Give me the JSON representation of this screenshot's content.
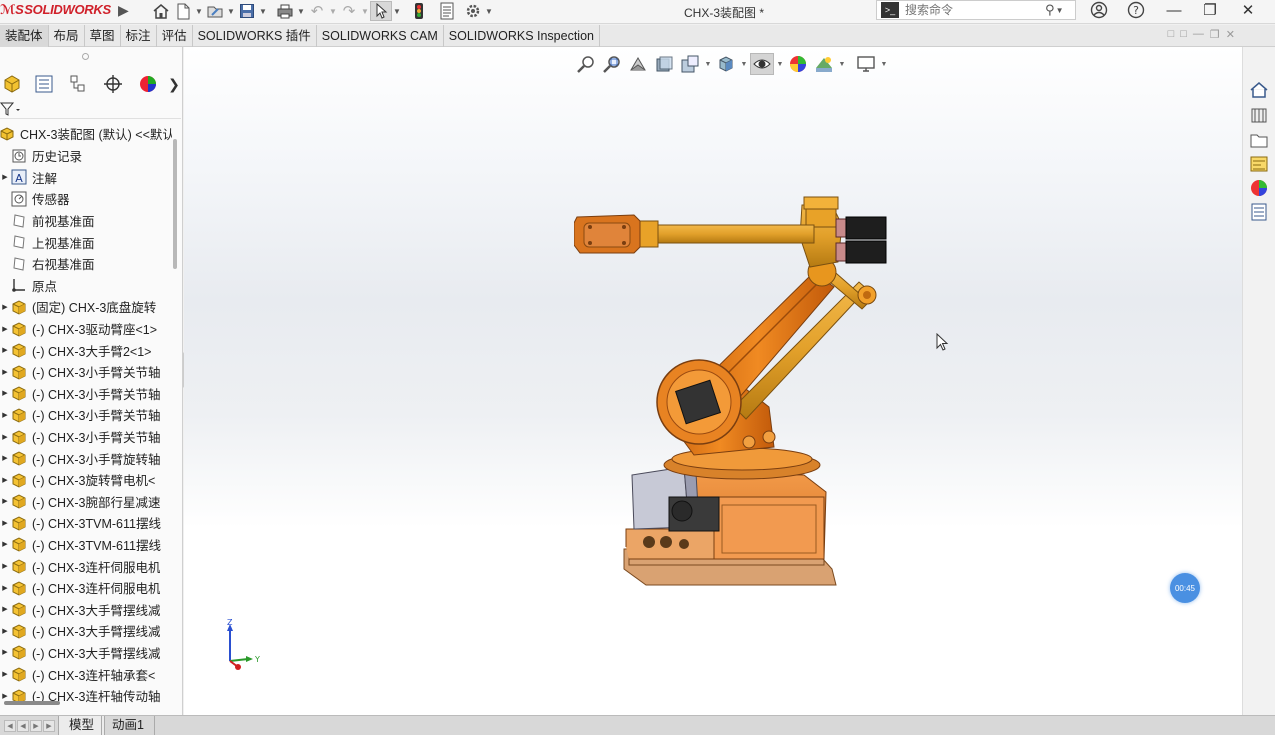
{
  "app": {
    "logo_prefix": "ℳS",
    "logo_text": "SOLIDWORKS",
    "document_title": "CHX-3装配图 *"
  },
  "search": {
    "placeholder": "搜索命令"
  },
  "command_tabs": [
    {
      "label": "装配体",
      "active": true
    },
    {
      "label": "布局"
    },
    {
      "label": "草图"
    },
    {
      "label": "标注"
    },
    {
      "label": "评估"
    },
    {
      "label": "SOLIDWORKS 插件"
    },
    {
      "label": "SOLIDWORKS CAM"
    },
    {
      "label": "SOLIDWORKS Inspection"
    }
  ],
  "tree": {
    "root": "CHX-3装配图 (默认) <<默认",
    "items": [
      {
        "label": "历史记录",
        "icon": "history-icon",
        "expand": false
      },
      {
        "label": "注解",
        "icon": "annotation-icon",
        "expand": true
      },
      {
        "label": "传感器",
        "icon": "sensor-icon",
        "expand": false
      },
      {
        "label": "前视基准面",
        "icon": "plane-icon",
        "expand": false
      },
      {
        "label": "上视基准面",
        "icon": "plane-icon",
        "expand": false
      },
      {
        "label": "右视基准面",
        "icon": "plane-icon",
        "expand": false
      },
      {
        "label": "原点",
        "icon": "origin-icon",
        "expand": false
      },
      {
        "label": "(固定) CHX-3底盘旋转",
        "icon": "part-icon",
        "expand": true
      },
      {
        "label": "(-) CHX-3驱动臂座<1>",
        "icon": "part-icon",
        "expand": true
      },
      {
        "label": "(-) CHX-3大手臂2<1>",
        "icon": "part-icon",
        "expand": true
      },
      {
        "label": "(-) CHX-3小手臂关节轴",
        "icon": "part-icon",
        "expand": true
      },
      {
        "label": "(-) CHX-3小手臂关节轴",
        "icon": "part-icon",
        "expand": true
      },
      {
        "label": "(-) CHX-3小手臂关节轴",
        "icon": "part-icon",
        "expand": true
      },
      {
        "label": "(-) CHX-3小手臂关节轴",
        "icon": "part-icon",
        "expand": true
      },
      {
        "label": "(-) CHX-3小手臂旋转轴",
        "icon": "part-icon",
        "expand": true
      },
      {
        "label": "(-) CHX-3旋转臂电机<",
        "icon": "part-icon",
        "expand": true
      },
      {
        "label": "(-) CHX-3腕部行星减速",
        "icon": "part-icon",
        "expand": true
      },
      {
        "label": "(-) CHX-3TVM-611摆线",
        "icon": "part-icon",
        "expand": true
      },
      {
        "label": "(-) CHX-3TVM-611摆线",
        "icon": "part-icon",
        "expand": true
      },
      {
        "label": "(-) CHX-3连杆伺服电机",
        "icon": "part-icon",
        "expand": true
      },
      {
        "label": "(-) CHX-3连杆伺服电机",
        "icon": "part-icon",
        "expand": true
      },
      {
        "label": "(-) CHX-3大手臂摆线减",
        "icon": "part-icon",
        "expand": true
      },
      {
        "label": "(-) CHX-3大手臂摆线减",
        "icon": "part-icon",
        "expand": true
      },
      {
        "label": "(-) CHX-3大手臂摆线减",
        "icon": "part-icon",
        "expand": true
      },
      {
        "label": "(-) CHX-3连杆轴承套<",
        "icon": "part-icon",
        "expand": true
      },
      {
        "label": "(-) CHX-3连杆轴传动轴",
        "icon": "part-icon",
        "expand": true
      }
    ]
  },
  "viewport": {
    "triad": {
      "z_label": "Z",
      "y_label": "Y"
    },
    "model_color": "#e07b1a",
    "timer": "00:45"
  },
  "bottom_tabs": [
    {
      "label": "模型",
      "active": true
    },
    {
      "label": "动画1",
      "active": false
    }
  ]
}
